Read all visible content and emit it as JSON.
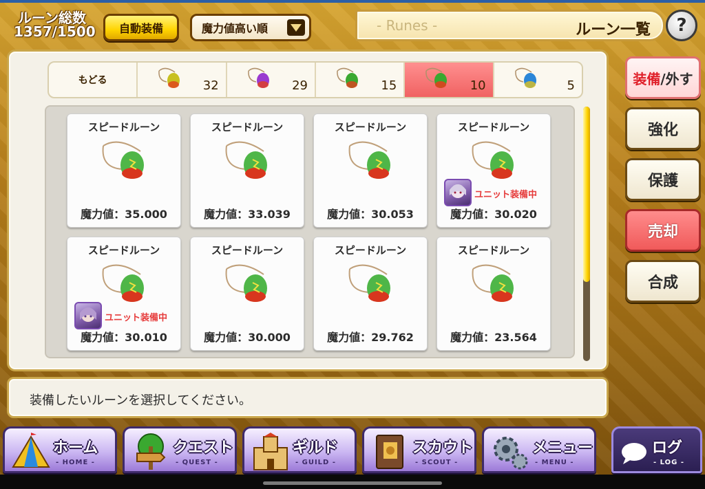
{
  "header": {
    "rune_count_label": "ルーン総数",
    "rune_count_value": "1357/1500",
    "auto_equip_label": "自動装備",
    "sort_selected": "魔力値高い順",
    "title_en": "- Runes -",
    "title_jp": "ルーン一覧",
    "help_label": "?"
  },
  "tabs": {
    "back_label": "もどる",
    "items": [
      {
        "count": "32",
        "gem_color": "#c8c020"
      },
      {
        "count": "29",
        "gem_color": "#9a3ad0"
      },
      {
        "count": "15",
        "gem_color": "#3aa830"
      },
      {
        "count": "10",
        "gem_color": "#e05a2a"
      },
      {
        "count": "5",
        "gem_color": "#2a86d8"
      }
    ],
    "active_index": 3
  },
  "runes": [
    {
      "name": "スピードルーン",
      "value": "魔力値：35.000"
    },
    {
      "name": "スピードルーン",
      "value": "魔力値：33.039"
    },
    {
      "name": "スピードルーン",
      "value": "魔力値：30.053"
    },
    {
      "name": "スピードルーン",
      "value": "魔力値：30.020",
      "equipped": "ユニット装備中"
    },
    {
      "name": "スピードルーン",
      "value": "魔力値：30.010",
      "equipped": "ユニット装備中"
    },
    {
      "name": "スピードルーン",
      "value": "魔力値：30.000"
    },
    {
      "name": "スピードルーン",
      "value": "魔力値：29.762"
    },
    {
      "name": "スピードルーン",
      "value": "魔力値：23.564"
    }
  ],
  "side_buttons": {
    "equip_a": "装備",
    "equip_b": "/外す",
    "enhance": "強化",
    "protect": "保護",
    "sell": "売却",
    "combine": "合成"
  },
  "message": "装備したいルーンを選択してください。",
  "nav": [
    {
      "label": "ホーム",
      "sub": "- HOME -",
      "icon": "tent-icon"
    },
    {
      "label": "クエスト",
      "sub": "- QUEST -",
      "icon": "signpost-icon"
    },
    {
      "label": "ギルド",
      "sub": "- GUILD -",
      "icon": "castle-icon"
    },
    {
      "label": "スカウト",
      "sub": "- SCOUT -",
      "icon": "book-icon"
    },
    {
      "label": "メニュー",
      "sub": "- MENU -",
      "icon": "gear-icon"
    },
    {
      "label": "ログ",
      "sub": "- LOG -",
      "icon": "chat-bubble-icon"
    }
  ],
  "colors": {
    "accent_gold": "#c9a64b",
    "active_tab": "#f06262",
    "equipped_text": "#e63a3a"
  }
}
